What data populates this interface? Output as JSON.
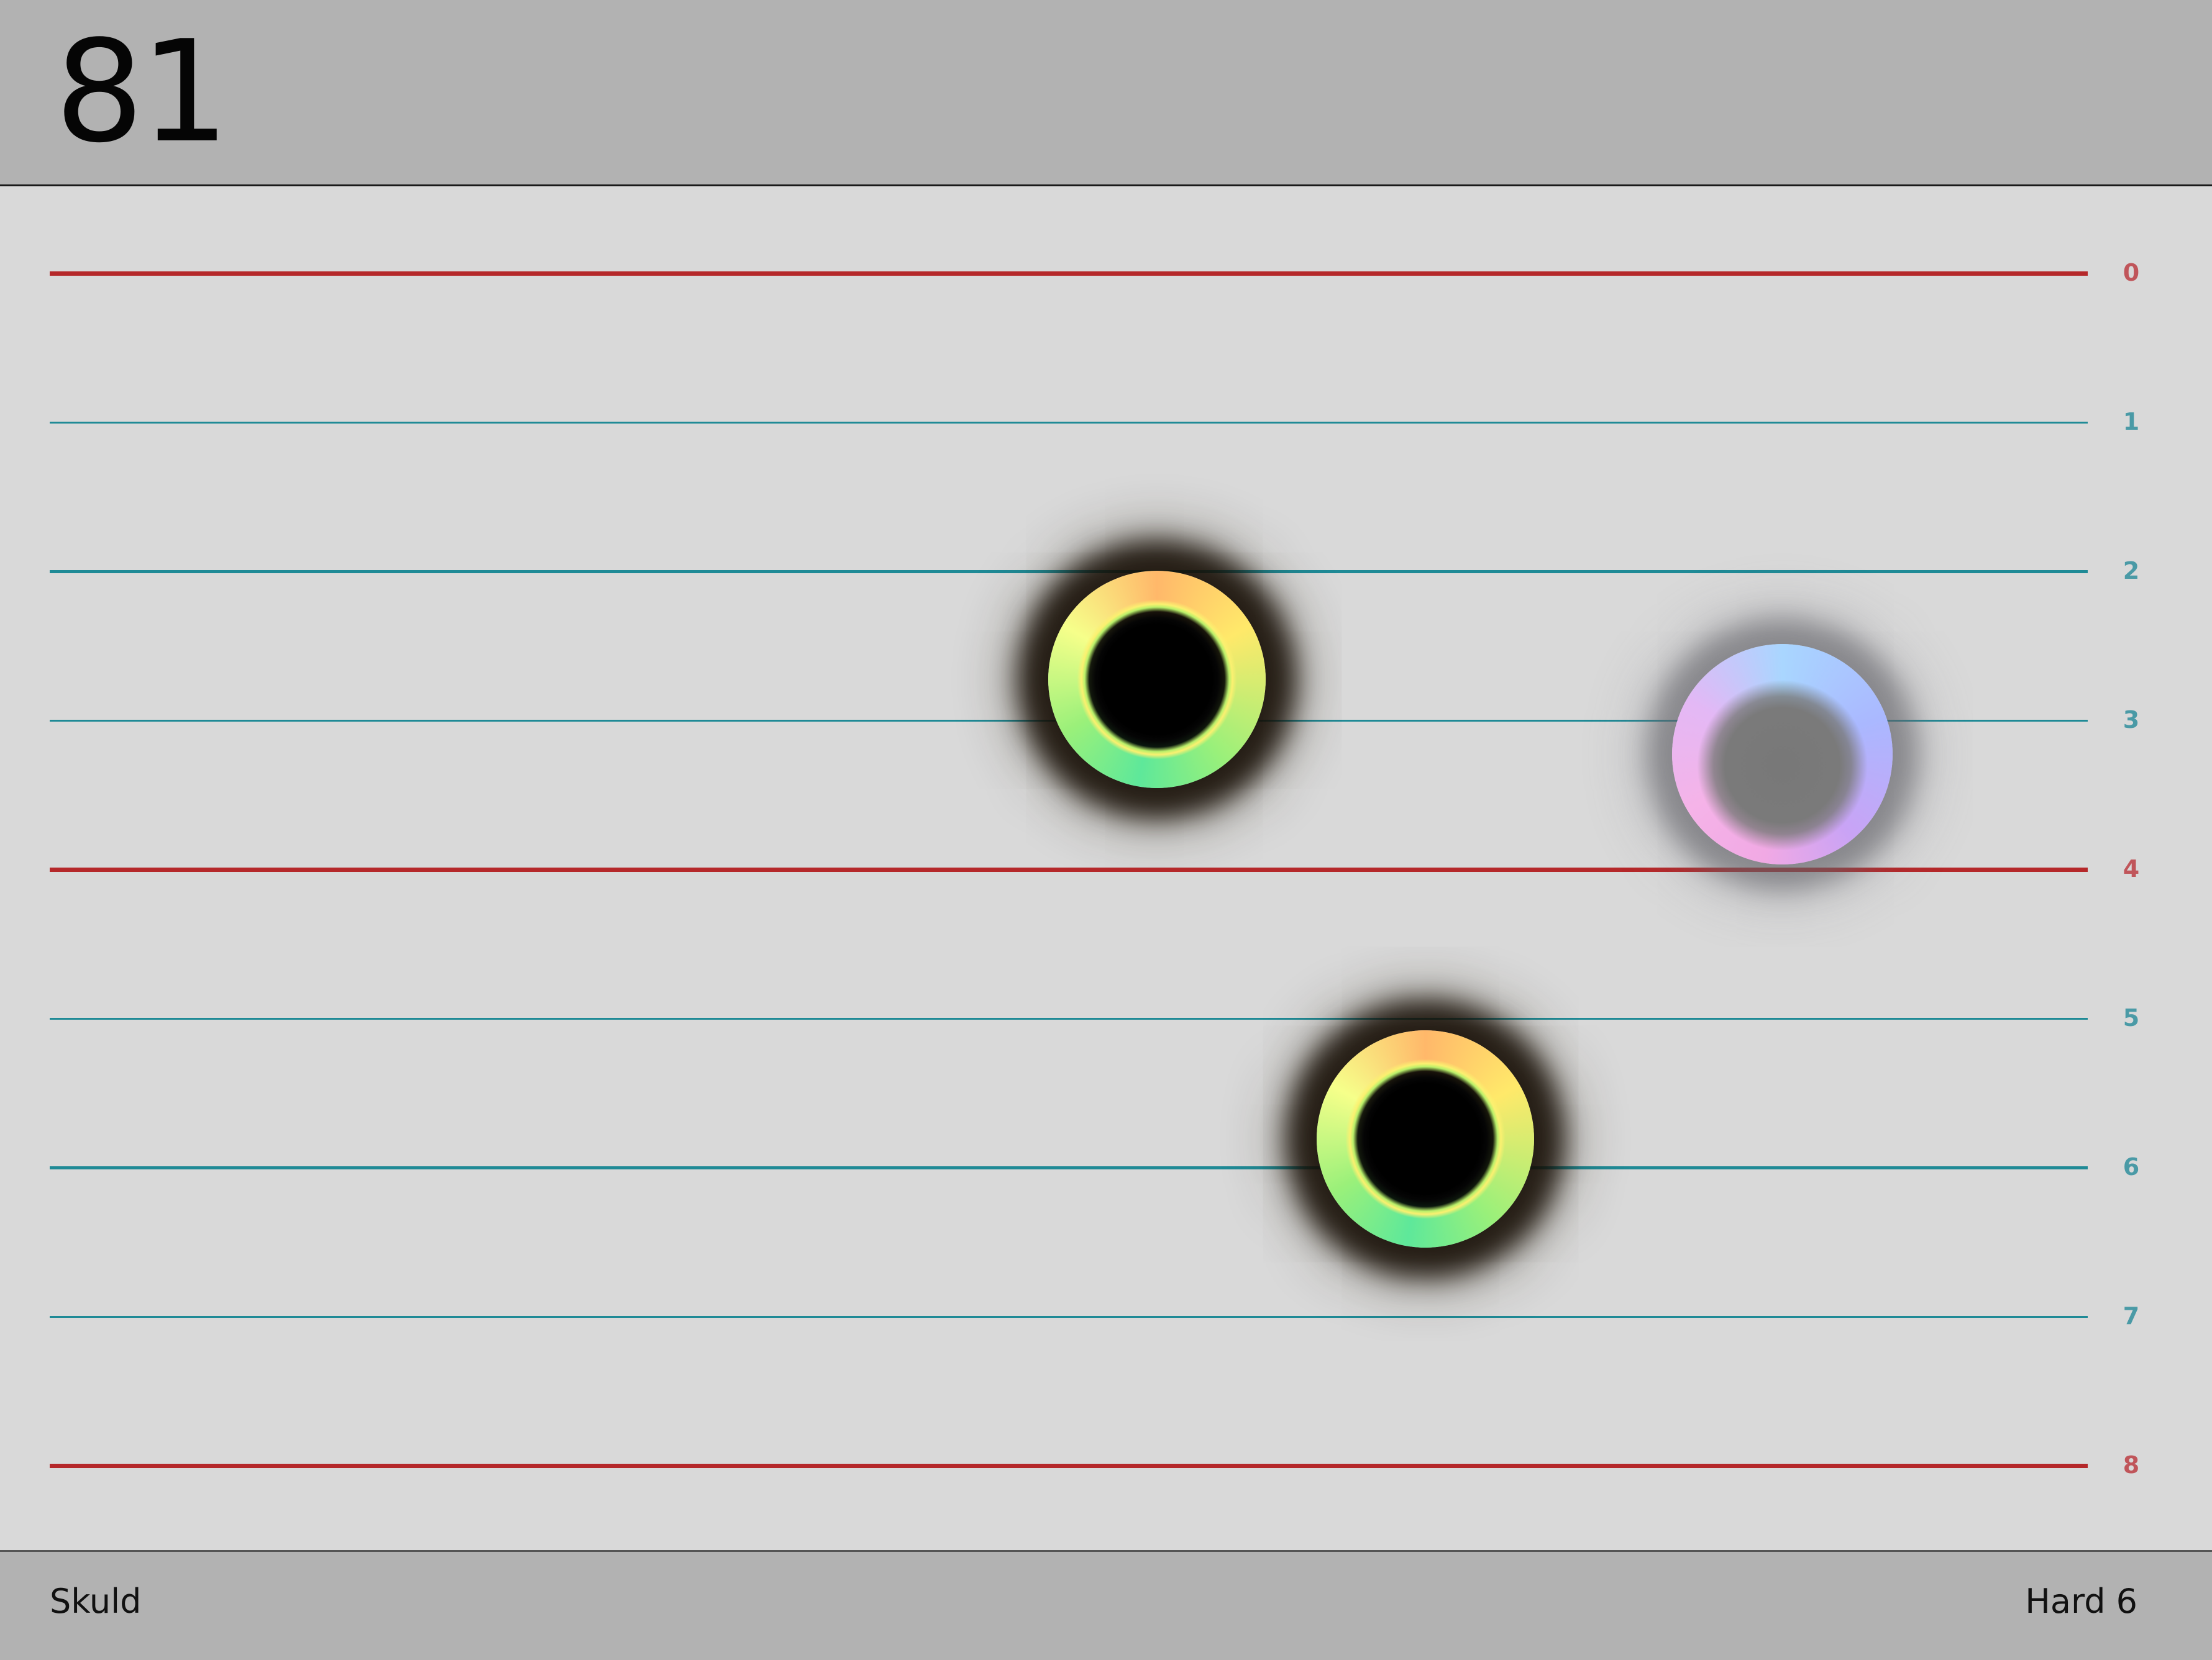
{
  "header": {
    "score": "81"
  },
  "lanes": [
    {
      "label": "0",
      "type": "boundary"
    },
    {
      "label": "1",
      "type": "inner"
    },
    {
      "label": "2",
      "type": "inner"
    },
    {
      "label": "3",
      "type": "inner"
    },
    {
      "label": "4",
      "type": "boundary"
    },
    {
      "label": "5",
      "type": "inner"
    },
    {
      "label": "6",
      "type": "inner"
    },
    {
      "label": "7",
      "type": "inner"
    },
    {
      "label": "8",
      "type": "boundary"
    }
  ],
  "colors": {
    "boundary_line": "#b5282a",
    "inner_line": "#1f8a96",
    "boundary_label": "#c0555a",
    "inner_label": "#4a9aa6"
  },
  "notes": [
    {
      "name": "note-orb-1",
      "style": "warm-spectrum",
      "lane": 2.7
    },
    {
      "name": "note-orb-2",
      "style": "cool-spectrum",
      "lane": 3.2
    },
    {
      "name": "note-orb-3",
      "style": "warm-spectrum",
      "lane": 5.8
    }
  ],
  "footer": {
    "song_title": "Skuld",
    "difficulty": "Hard 6"
  }
}
